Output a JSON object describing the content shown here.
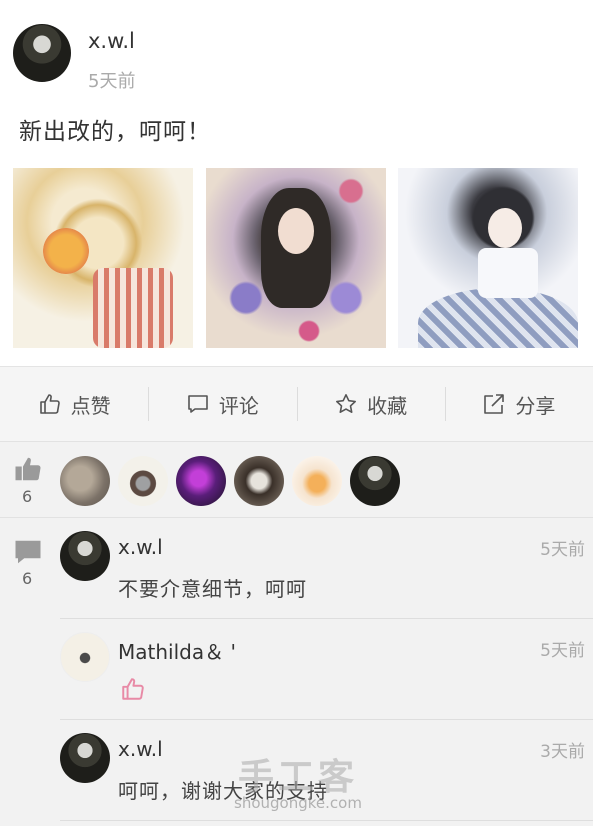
{
  "post": {
    "author": "x.w.l",
    "time": "5天前",
    "text": "新出改的，呵呵！",
    "photos": [
      "photo-1",
      "photo-2",
      "photo-3"
    ]
  },
  "actions": {
    "like_label": "点赞",
    "comment_label": "评论",
    "favorite_label": "收藏",
    "share_label": "分享"
  },
  "likes": {
    "count": "6",
    "likers": [
      "liker-1",
      "liker-2",
      "liker-3",
      "liker-4",
      "liker-5",
      "liker-6"
    ]
  },
  "comments": {
    "count": "6",
    "items": [
      {
        "name": "x.w.l",
        "time": "5天前",
        "text": "不要介意细节，呵呵"
      },
      {
        "name": "Mathilda＆ '",
        "time": "5天前",
        "text": ""
      },
      {
        "name": "x.w.l",
        "time": "3天前",
        "text": "呵呵，谢谢大家的支持"
      }
    ]
  },
  "watermark": {
    "main": "手工客",
    "sub": "shougongke.com"
  },
  "colors": {
    "icon_gray": "#9a9a9a",
    "pink_thumb": "#e88aa6"
  }
}
